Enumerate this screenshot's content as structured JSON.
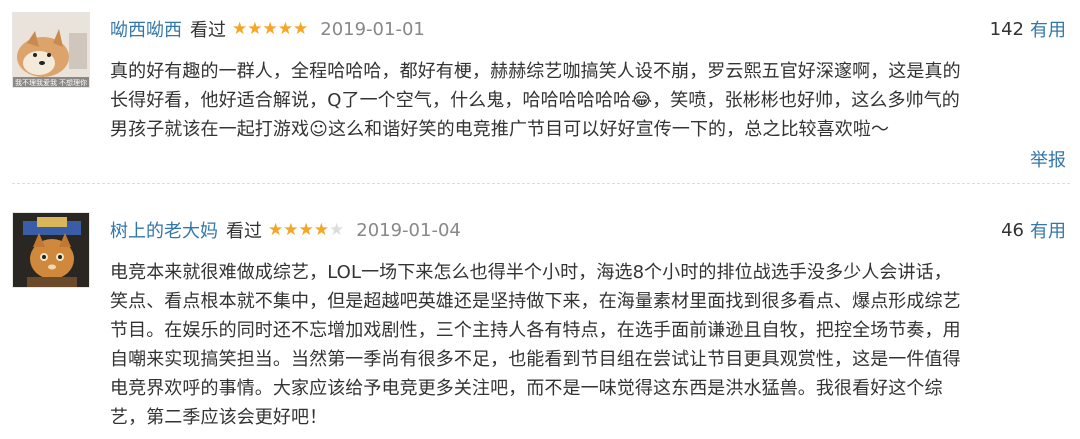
{
  "reviews": [
    {
      "username": "呦西呦西",
      "status": "看过",
      "rating": 5,
      "max_rating": 5,
      "date": "2019-01-01",
      "useful_count": "142",
      "useful_label": "有用",
      "content_lines": [
        "真的好有趣的一群人，全程哈哈哈，都好有梗，赫赫综艺咖搞笑人设不崩，罗云熙五官好深邃啊，这是真的",
        "长得好看，他好适合解说，Q了一个空气，什么鬼，哈哈哈哈哈哈😂，笑喷，张彬彬也好帅，这么多帅气的",
        "男孩子就该在一起打游戏☺这么和谐好笑的电竞推广节目可以好好宣传一下的，总之比较喜欢啦～"
      ],
      "report_label": "举报",
      "avatar_text_left": "我不理我爱我",
      "avatar_text_right": "不想理你"
    },
    {
      "username": "树上的老大妈",
      "status": "看过",
      "rating": 4,
      "max_rating": 5,
      "date": "2019-01-04",
      "useful_count": "46",
      "useful_label": "有用",
      "content_lines": [
        "电竞本来就很难做成综艺，LOL一场下来怎么也得半个小时，海选8个小时的排位战选手没多少人会讲话，",
        "笑点、看点根本就不集中，但是超越吧英雄还是坚持做下来，在海量素材里面找到很多看点、爆点形成综艺",
        "节目。在娱乐的同时还不忘增加戏剧性，三个主持人各有特点，在选手面前谦逊且自牧，把控全场节奏，用",
        "自嘲来实现搞笑担当。当然第一季尚有很多不足，也能看到节目组在尝试让节目更具观赏性，这是一件值得",
        "电竞界欢呼的事情。大家应该给予电竞更多关注吧，而不是一味觉得这东西是洪水猛兽。我很看好这个综",
        "艺，第二季应该会更好吧！"
      ]
    }
  ],
  "colors": {
    "link": "#3377aa",
    "star": "#f5a623",
    "star_empty": "#dddddd",
    "date": "#888888"
  },
  "icons": {
    "star_full": "star-icon",
    "star_empty": "star-empty-icon"
  }
}
